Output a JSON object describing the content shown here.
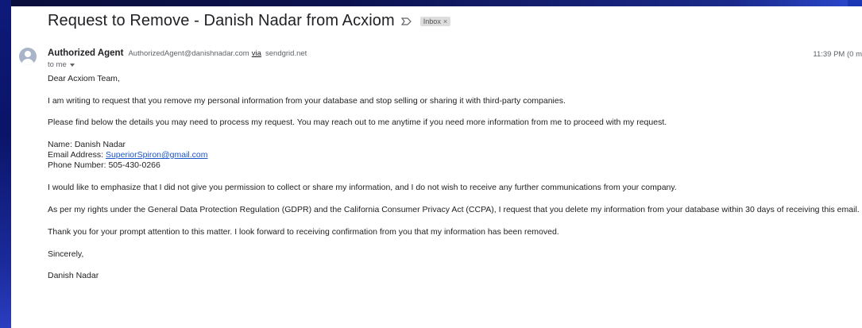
{
  "email": {
    "subject": "Request to Remove - Danish Nadar from Acxiom",
    "label": "Inbox",
    "label_close": "×",
    "sender": {
      "name": "Authorized Agent",
      "email": "AuthorizedAgent@danishnadar.com",
      "via_label": "via",
      "via_domain": "sendgrid.net"
    },
    "timestamp": "11:39 PM (0 m",
    "recipient": "to me",
    "body": {
      "greeting": "Dear Acxiom Team,",
      "p1": "I am writing to request that you remove my personal information from your database and stop selling or sharing it with third-party companies.",
      "p2": "Please find below the details you may need to process my request. You may reach out to me anytime if you need more information from me to proceed with my request.",
      "name_line": "Name: Danish Nadar",
      "email_label": "Email Address: ",
      "email_value": "SuperiorSpiron@gmail.com",
      "phone_line": "Phone Number: 505-430-0266",
      "p3": "I would like to emphasize that I did not give you permission to collect or share my information, and I do not wish to receive any further communications from your company.",
      "p4": "As per my rights under the General Data Protection Regulation (GDPR) and the California Consumer Privacy Act (CCPA), I request that you delete my information from your database within 30 days of receiving this email.",
      "p5": "Thank you for your prompt attention to this matter. I look forward to receiving confirmation from you that my information has been removed.",
      "closing": "Sincerely,",
      "signature": "Danish Nadar"
    }
  },
  "icons": {
    "importance": "importance-marker-icon",
    "avatar": "avatar-icon",
    "caret": "chevron-down-icon"
  },
  "colors": {
    "link": "#1a55c9",
    "background_frame": "#0b0f40",
    "panel": "#ffffff"
  }
}
